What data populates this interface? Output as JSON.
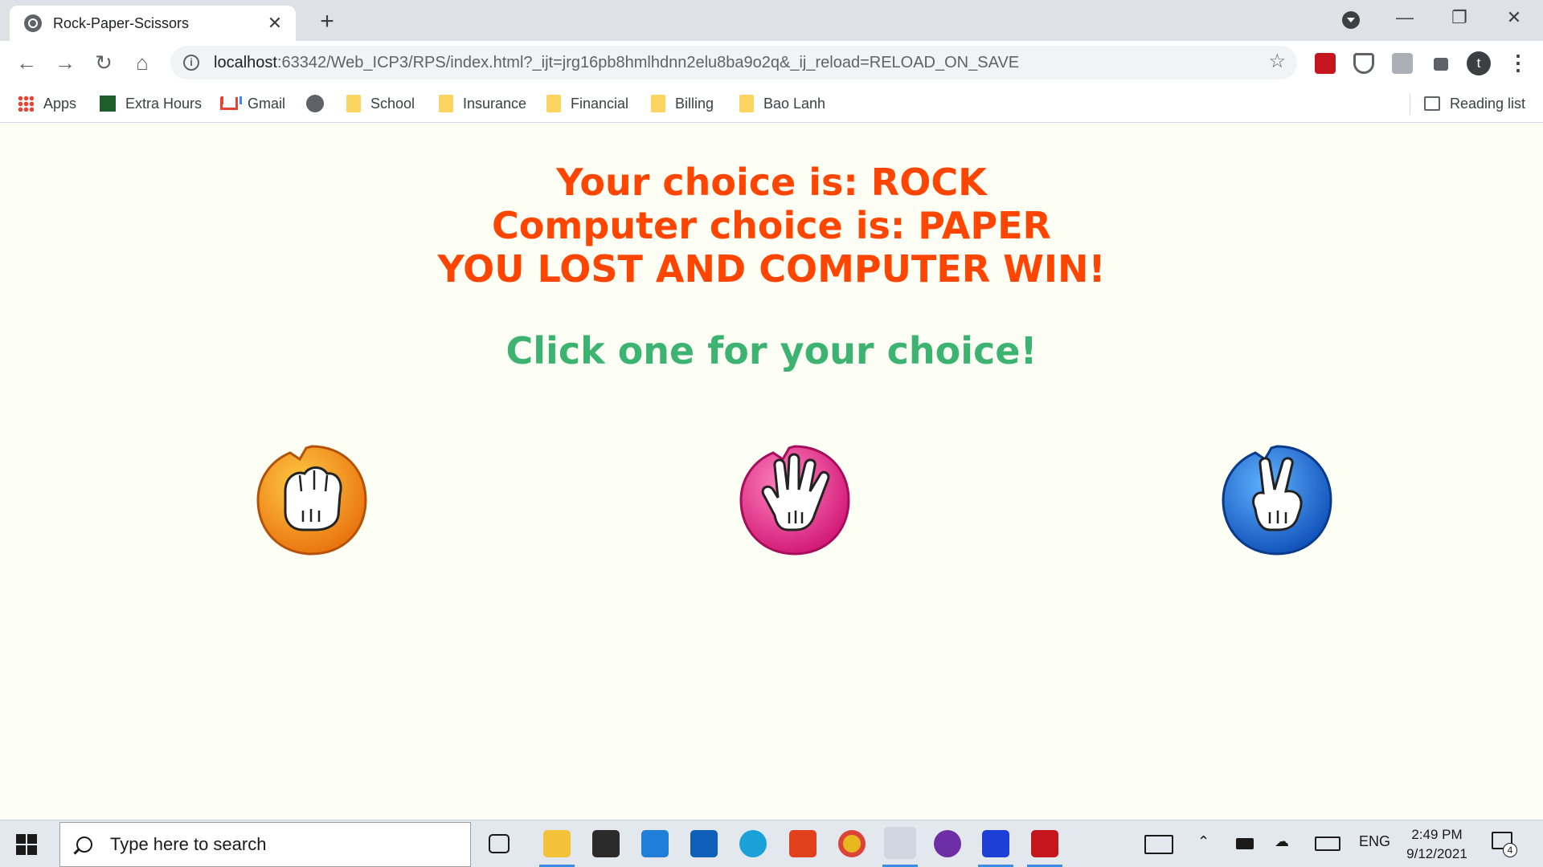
{
  "browser": {
    "tab_title": "Rock-Paper-Scissors",
    "url_host": "localhost",
    "url_rest": ":63342/Web_ICP3/RPS/index.html?_ijt=jrg16pb8hmlhdnn2elu8ba9o2q&_ij_reload=RELOAD_ON_SAVE",
    "profile_initial": "t",
    "bookmarks": [
      {
        "label": "Apps",
        "icon": "apps-grid-icon"
      },
      {
        "label": "Extra Hours",
        "icon": "extra-hours-icon"
      },
      {
        "label": "Gmail",
        "icon": "gmail-icon"
      },
      {
        "label": "",
        "icon": "globe-icon"
      },
      {
        "label": "School",
        "icon": "folder-icon"
      },
      {
        "label": "Insurance",
        "icon": "folder-icon"
      },
      {
        "label": "Financial",
        "icon": "folder-icon"
      },
      {
        "label": "Billing",
        "icon": "folder-icon"
      },
      {
        "label": "Bao Lanh",
        "icon": "folder-icon"
      }
    ],
    "reading_list": "Reading list"
  },
  "game": {
    "user_choice_line": "Your choice is: ROCK",
    "computer_choice_line": "Computer choice is: PAPER",
    "outcome_line": "YOU LOST AND COMPUTER WIN!",
    "prompt": "Click one for your choice!",
    "result_color": "#ff4500",
    "prompt_color": "#3cb371",
    "choices": [
      {
        "name": "rock",
        "color": "#f7941d"
      },
      {
        "name": "paper",
        "color": "#ec2f8c"
      },
      {
        "name": "scissors",
        "color": "#1f6fd6"
      }
    ]
  },
  "taskbar": {
    "search_placeholder": "Type here to search",
    "language": "ENG",
    "time": "2:49 PM",
    "date": "9/12/2021",
    "notification_count": "4"
  }
}
